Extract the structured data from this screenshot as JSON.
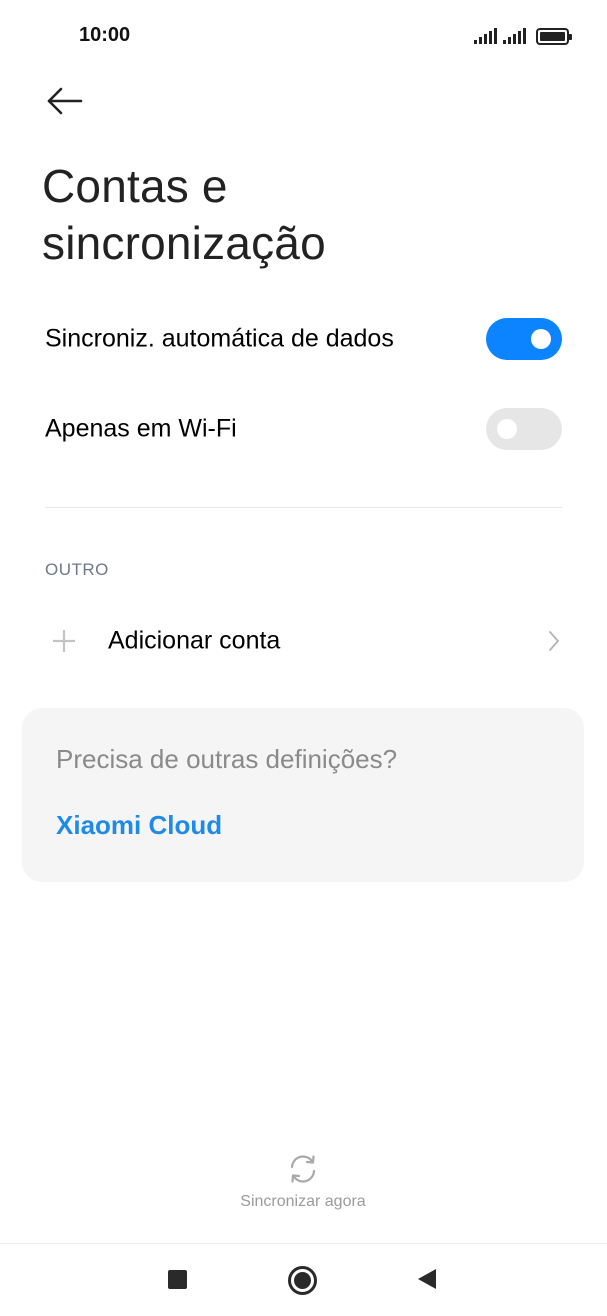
{
  "status_bar": {
    "time": "10:00",
    "icons": [
      "signal-icon",
      "signal-icon",
      "battery-icon"
    ]
  },
  "header": {
    "back_icon": "arrow-left-icon",
    "title_line1": "Contas e",
    "title_line2": "sincronização"
  },
  "settings": [
    {
      "label": "Sincroniz. automática de dados",
      "state": "on"
    },
    {
      "label": "Apenas em Wi-Fi",
      "state": "off"
    }
  ],
  "section": {
    "header": "OUTRO",
    "add_account": {
      "label": "Adicionar conta",
      "icon": "plus-icon",
      "chevron": "chevron-right-icon"
    }
  },
  "card": {
    "question": "Precisa de outras definições?",
    "link": "Xiaomi Cloud"
  },
  "sync": {
    "label": "Sincronizar agora",
    "icon": "sync-icon"
  },
  "colors": {
    "accent": "#0d84ff",
    "link": "#1f8ae8",
    "toggle_off": "#e6e6e6",
    "card_bg": "#f5f5f5"
  },
  "nav_bar": {
    "icons": [
      "recent-apps-icon",
      "home-icon",
      "back-triangle-icon"
    ]
  }
}
